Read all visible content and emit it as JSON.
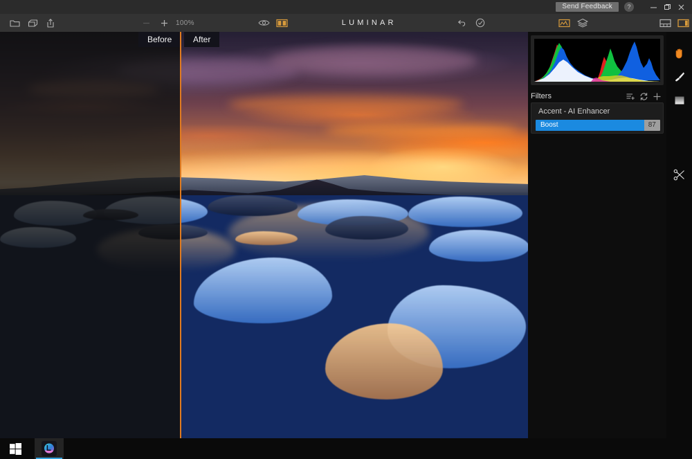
{
  "window": {
    "title": "LUMINAR",
    "send_feedback_label": "Send Feedback",
    "help_label": "?",
    "controls": {
      "minimize": "minimize-icon",
      "restore": "restore-icon",
      "close": "close-icon"
    }
  },
  "toolbar": {
    "left_icons": [
      {
        "name": "open-folder-icon",
        "label": "Open"
      },
      {
        "name": "export-box-icon",
        "label": "Export"
      },
      {
        "name": "share-icon",
        "label": "Share"
      }
    ],
    "zoom": {
      "minus_label": "−",
      "plus_label": "+",
      "level": "100%"
    },
    "view_icons": [
      {
        "name": "eye-icon",
        "label": "Preview",
        "active": false
      },
      {
        "name": "split-view-icon",
        "label": "Compare",
        "active": true
      }
    ],
    "history_icons": [
      {
        "name": "undo-icon",
        "label": "Undo"
      },
      {
        "name": "checkmark-circle-icon",
        "label": "Apply"
      }
    ],
    "right_icons": [
      {
        "name": "histogram-icon",
        "label": "Histogram",
        "active": true
      },
      {
        "name": "layers-icon",
        "label": "Layers",
        "active": false
      },
      {
        "name": "filmstrip-panel-icon",
        "label": "Filmstrip",
        "active": false
      },
      {
        "name": "side-panel-icon",
        "label": "Side Panel",
        "active": true
      }
    ]
  },
  "canvas": {
    "before_label": "Before",
    "after_label": "After",
    "divider_color": "#e07b20"
  },
  "panel": {
    "filters_title": "Filters",
    "header_icons": [
      {
        "name": "add-to-list-icon",
        "label": "Add filter to list"
      },
      {
        "name": "sync-icon",
        "label": "Reset filters"
      },
      {
        "name": "plus-icon",
        "label": "Add filter"
      }
    ],
    "filters": [
      {
        "name": "Accent - AI Enhancer",
        "slider_label": "Boost",
        "slider_value": "87",
        "slider_percent": 87,
        "slider_color": "#1b8ae0"
      }
    ]
  },
  "rail": {
    "tools": [
      {
        "name": "hand-icon",
        "label": "Pan",
        "color": "#f08a22"
      },
      {
        "name": "brush-icon",
        "label": "Brush",
        "color": "#e8e8e8"
      },
      {
        "name": "gradient-mask-icon",
        "label": "Gradient Mask",
        "color": "#c8c8c8"
      },
      {
        "name": "scissors-crop-icon",
        "label": "Crop",
        "color": "#e0e0e0"
      }
    ]
  },
  "taskbar": {
    "start_label": "Start",
    "apps": [
      {
        "name": "luminar-taskbar-icon",
        "label": "Luminar",
        "active": true
      }
    ]
  }
}
